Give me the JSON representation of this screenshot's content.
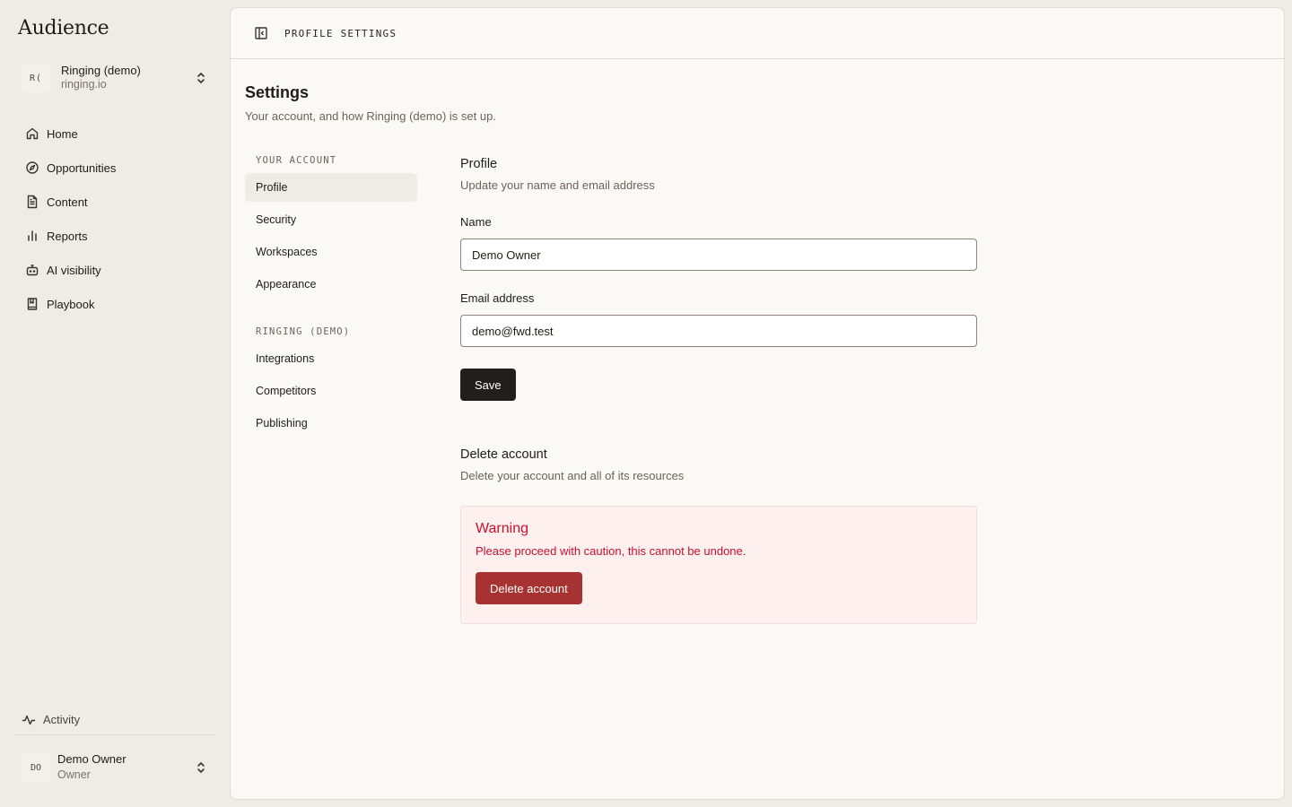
{
  "app": {
    "brand": "Audience"
  },
  "workspace": {
    "initials": "R(",
    "name": "Ringing (demo)",
    "domain": "ringing.io"
  },
  "nav": {
    "items": [
      {
        "label": "Home",
        "icon": "home-icon"
      },
      {
        "label": "Opportunities",
        "icon": "compass-icon"
      },
      {
        "label": "Content",
        "icon": "document-icon"
      },
      {
        "label": "Reports",
        "icon": "bar-chart-icon"
      },
      {
        "label": "AI visibility",
        "icon": "robot-icon"
      },
      {
        "label": "Playbook",
        "icon": "book-icon"
      }
    ]
  },
  "activity": {
    "label": "Activity",
    "icon": "activity-icon"
  },
  "user": {
    "initials": "DO",
    "name": "Demo Owner",
    "role": "Owner"
  },
  "topbar": {
    "title": "PROFILE SETTINGS"
  },
  "page": {
    "title": "Settings",
    "subtitle": "Your account, and how Ringing (demo) is set up."
  },
  "settings_nav": {
    "account_heading": "YOUR ACCOUNT",
    "account_items": [
      "Profile",
      "Security",
      "Workspaces",
      "Appearance"
    ],
    "org_heading": "RINGING (DEMO)",
    "org_items": [
      "Integrations",
      "Competitors",
      "Publishing"
    ],
    "active": "Profile"
  },
  "profile": {
    "title": "Profile",
    "subtitle": "Update your name and email address",
    "name_label": "Name",
    "name_value": "Demo Owner",
    "email_label": "Email address",
    "email_value": "demo@fwd.test",
    "save_label": "Save"
  },
  "delete": {
    "title": "Delete account",
    "subtitle": "Delete your account and all of its resources",
    "warning_title": "Warning",
    "warning_text": "Please proceed with caution, this cannot be undone.",
    "button_label": "Delete account"
  },
  "colors": {
    "sidebar_bg": "#efebe5",
    "main_bg": "#faf9f6",
    "primary_button": "#221e1b",
    "danger_button": "#a73232",
    "warning_text": "#c8102e",
    "warning_bg": "#fff0f0"
  }
}
